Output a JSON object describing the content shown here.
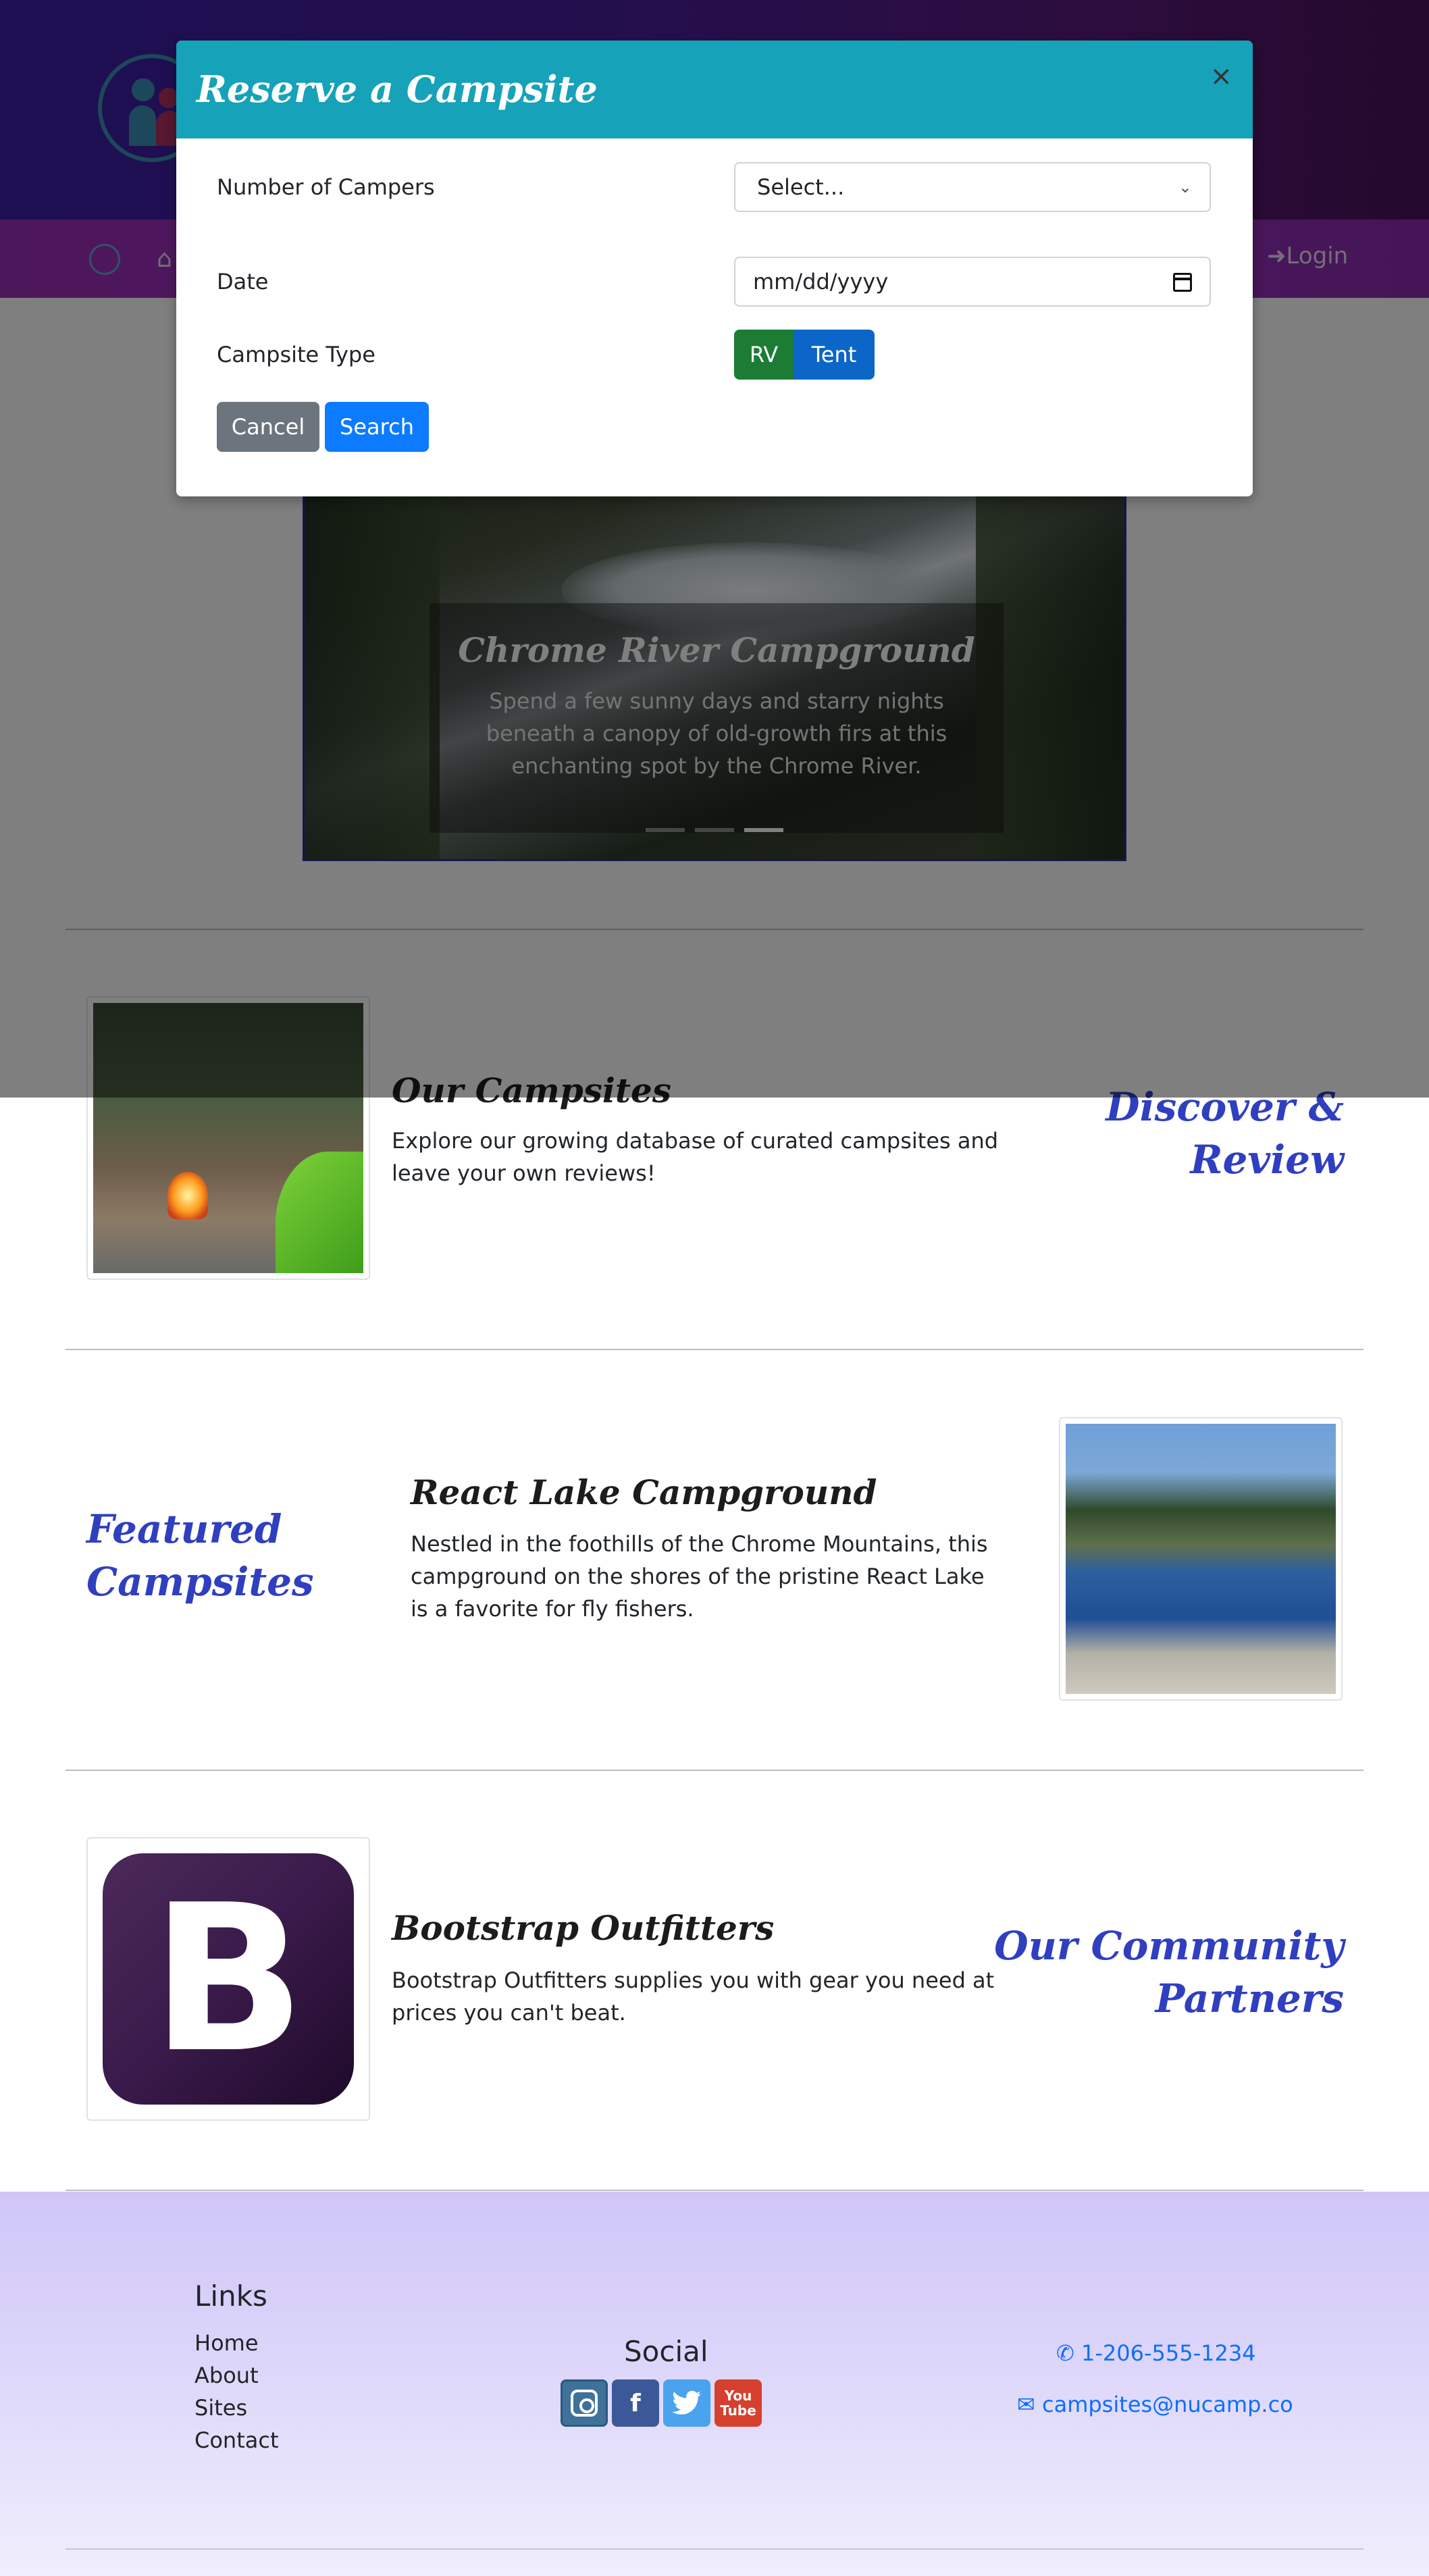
{
  "modal": {
    "title": "Reserve a Campsite",
    "close": "×",
    "campers_label": "Number of Campers",
    "campers_value": "Select...",
    "date_label": "Date",
    "date_placeholder": "mm/dd/yyyy",
    "type_label": "Campsite Type",
    "type_rv": "RV",
    "type_tent": "Tent",
    "cancel_label": "Cancel",
    "search_label": "Search"
  },
  "nav": {
    "login_label": "Login"
  },
  "carousel": {
    "title": "Chrome River Campground",
    "text": "Spend a few sunny days and starry nights beneath a canopy of old-growth firs at this enchanting spot by the Chrome River."
  },
  "sections": {
    "campsites": {
      "title": "Our Campsites",
      "text": "Explore our growing database of curated campsites and leave your own reviews!",
      "heading_line1": "Discover &",
      "heading_line2": "Review"
    },
    "featured": {
      "heading_line1": "Featured",
      "heading_line2": "Campsites",
      "title": "React Lake Campground",
      "text": "Nestled in the foothills of the Chrome Mountains, this campground on the shores of the pristine React Lake is a favorite for fly fishers."
    },
    "partners": {
      "title": "Bootstrap Outfitters",
      "text": "Bootstrap Outfitters supplies you with gear you need at prices you can't beat.",
      "heading_line1": "Our Community",
      "heading_line2": "Partners",
      "logo_letter": "B"
    }
  },
  "footer": {
    "links_title": "Links",
    "links": [
      "Home",
      "About",
      "Sites",
      "Contact"
    ],
    "social_title": "Social",
    "social_icons": [
      "instagram-icon",
      "facebook-icon",
      "twitter-icon",
      "youtube-icon"
    ],
    "facebook_glyph": "f",
    "youtube_glyph": "You Tube",
    "phone": "1-206-555-1234",
    "email": "campsites@nucamp.co"
  },
  "colors": {
    "accent": "#2f3fc0",
    "modal_header": "#16a2b8",
    "search_button": "#0d7bff",
    "rv_button": "#1c7c34",
    "tent_button": "#0b66c8"
  }
}
